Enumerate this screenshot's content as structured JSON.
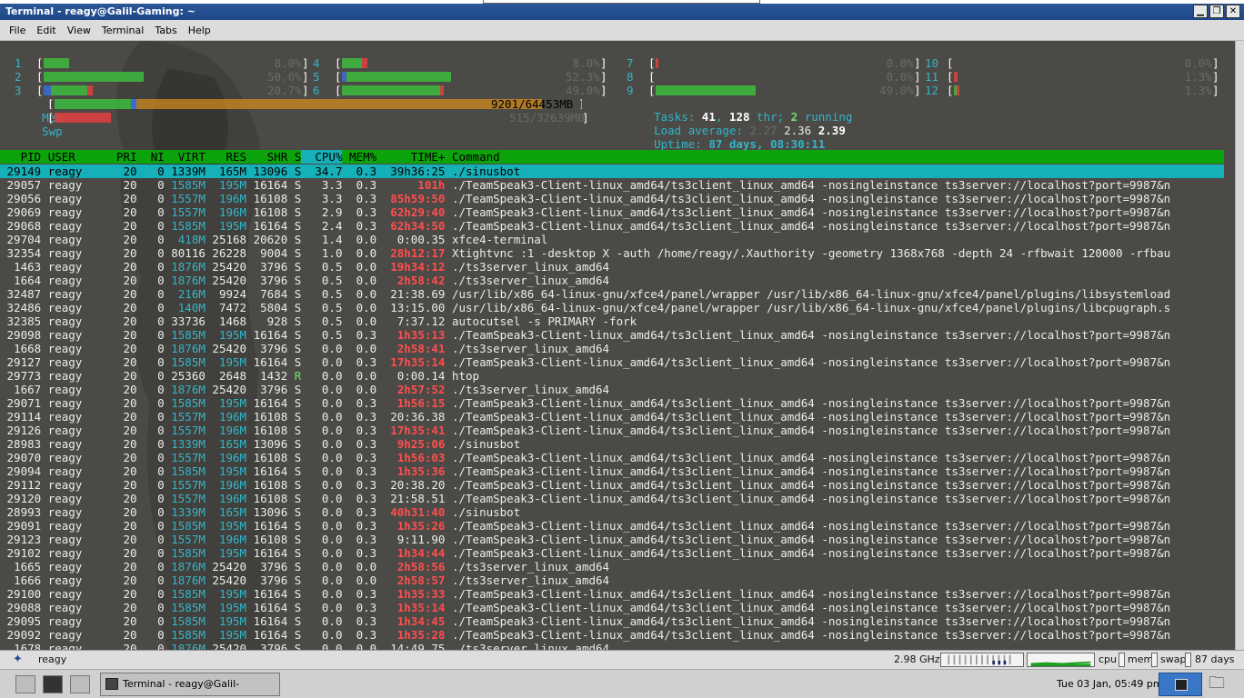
{
  "window": {
    "title": "Terminal - reagy@Galil-Gaming: ~",
    "min_glyph": "▁",
    "max_glyph": "❐",
    "close_glyph": "✕"
  },
  "menu": [
    "File",
    "Edit",
    "View",
    "Terminal",
    "Tabs",
    "Help"
  ],
  "htop": {
    "cpus_left": [
      {
        "label": "1",
        "val": "8.0%"
      },
      {
        "label": "2",
        "val": "50.0%"
      },
      {
        "label": "3",
        "val": "20.7%"
      }
    ],
    "cpus_mid": [
      {
        "label": "4",
        "val": "8.0%"
      },
      {
        "label": "5",
        "val": "52.3%"
      },
      {
        "label": "6",
        "val": "49.0%"
      }
    ],
    "cpus_r1": [
      {
        "label": "7",
        "val": "0.0%"
      },
      {
        "label": "8",
        "val": "0.0%"
      },
      {
        "label": "9",
        "val": "49.0%"
      }
    ],
    "cpus_r2": [
      {
        "label": "10",
        "val": "0.0%"
      },
      {
        "label": "11",
        "val": "1.3%"
      },
      {
        "label": "12",
        "val": "1.3%"
      }
    ],
    "mem": {
      "label": "Mem",
      "val": "9201/64453MB"
    },
    "swp": {
      "label": "Swp",
      "val": "515/32639MB"
    },
    "tasks_prefix": "Tasks: ",
    "tasks": "41",
    "tasks_sep": ", ",
    "thr": "128",
    "thr_suffix": " thr; ",
    "running": "2",
    "running_suffix": " running",
    "load_label": "Load average: ",
    "load1": "2.27",
    "load5": "2.36",
    "load15": "2.39",
    "uptime_label": "Uptime: ",
    "uptime": "87 days, 08:30:11"
  },
  "header": {
    "pid": "PID",
    "user": "USER",
    "pri": "PRI",
    "ni": "NI",
    "virt": "VIRT",
    "res": "RES",
    "shr": "SHR",
    "s": "S",
    "cpu": "CPU%",
    "mem": "MEM%",
    "time": "TIME+",
    "cmd": "Command"
  },
  "processes": [
    [
      "29149",
      "reagy",
      "20",
      "0",
      "1339M",
      "165M",
      "13096",
      "S",
      "34.7",
      "0.3",
      "39h36:25",
      "./sinusbot"
    ],
    [
      "29057",
      "reagy",
      "20",
      "0",
      "1585M",
      "195M",
      "16164",
      "S",
      "3.3",
      "0.3",
      "101h",
      "./TeamSpeak3-Client-linux_amd64/ts3client_linux_amd64 -nosinglеinstance ts3server://localhost?port=9987&n"
    ],
    [
      "29056",
      "reagy",
      "20",
      "0",
      "1557M",
      "196M",
      "16108",
      "S",
      "3.3",
      "0.3",
      "85h59:50",
      "./TeamSpeak3-Client-linux_amd64/ts3client_linux_amd64 -nosinglеinstance ts3server://localhost?port=9987&n"
    ],
    [
      "29069",
      "reagy",
      "20",
      "0",
      "1557M",
      "196M",
      "16108",
      "S",
      "2.9",
      "0.3",
      "62h29:40",
      "./TeamSpeak3-Client-linux_amd64/ts3client_linux_amd64 -nosinglеinstance ts3server://localhost?port=9987&n"
    ],
    [
      "29068",
      "reagy",
      "20",
      "0",
      "1585M",
      "195M",
      "16164",
      "S",
      "2.4",
      "0.3",
      "62h34:50",
      "./TeamSpeak3-Client-linux_amd64/ts3client_linux_amd64 -nosinglеinstance ts3server://localhost?port=9987&n"
    ],
    [
      "29704",
      "reagy",
      "20",
      "0",
      "418M",
      "25168",
      "20620",
      "S",
      "1.4",
      "0.0",
      "0:00.35",
      "xfce4-terminal"
    ],
    [
      "32354",
      "reagy",
      "20",
      "0",
      "80116",
      "26228",
      "9004",
      "S",
      "1.0",
      "0.0",
      "28h12:17",
      "Xtightvnc :1 -desktop X -auth /home/reagy/.Xauthority -geometry 1368x768 -depth 24 -rfbwait 120000 -rfbau"
    ],
    [
      "1463",
      "reagy",
      "20",
      "0",
      "1876M",
      "25420",
      "3796",
      "S",
      "0.5",
      "0.0",
      "19h34:12",
      "./ts3server_linux_amd64"
    ],
    [
      "1664",
      "reagy",
      "20",
      "0",
      "1876M",
      "25420",
      "3796",
      "S",
      "0.5",
      "0.0",
      "2h58:42",
      "./ts3server_linux_amd64"
    ],
    [
      "32487",
      "reagy",
      "20",
      "0",
      "216M",
      "9924",
      "7684",
      "S",
      "0.5",
      "0.0",
      "21:38.69",
      "/usr/lib/x86_64-linux-gnu/xfce4/panel/wrapper /usr/lib/x86_64-linux-gnu/xfce4/panel/plugins/libsystemload"
    ],
    [
      "32486",
      "reagy",
      "20",
      "0",
      "140M",
      "7472",
      "5804",
      "S",
      "0.5",
      "0.0",
      "13:15.00",
      "/usr/lib/x86_64-linux-gnu/xfce4/panel/wrapper /usr/lib/x86_64-linux-gnu/xfce4/panel/plugins/libcpugraph.s"
    ],
    [
      "32385",
      "reagy",
      "20",
      "0",
      "33736",
      "1468",
      "928",
      "S",
      "0.5",
      "0.0",
      "7:37.12",
      "autocutsel -s PRIMARY -fork"
    ],
    [
      "29098",
      "reagy",
      "20",
      "0",
      "1585M",
      "195M",
      "16164",
      "S",
      "0.5",
      "0.3",
      "1h35:13",
      "./TeamSpeak3-Client-linux_amd64/ts3client_linux_amd64 -nosinglеinstance ts3server://localhost?port=9987&n"
    ],
    [
      "1668",
      "reagy",
      "20",
      "0",
      "1876M",
      "25420",
      "3796",
      "S",
      "0.0",
      "0.0",
      "2h58:41",
      "./ts3server_linux_amd64"
    ],
    [
      "29127",
      "reagy",
      "20",
      "0",
      "1585M",
      "195M",
      "16164",
      "S",
      "0.0",
      "0.3",
      "17h35:14",
      "./TeamSpeak3-Client-linux_amd64/ts3client_linux_amd64 -nosinglеinstance ts3server://localhost?port=9987&n"
    ],
    [
      "29773",
      "reagy",
      "20",
      "0",
      "25360",
      "2648",
      "1432",
      "R",
      "0.0",
      "0.0",
      "0:00.14",
      "htop"
    ],
    [
      "1667",
      "reagy",
      "20",
      "0",
      "1876M",
      "25420",
      "3796",
      "S",
      "0.0",
      "0.0",
      "2h57:52",
      "./ts3server_linux_amd64"
    ],
    [
      "29071",
      "reagy",
      "20",
      "0",
      "1585M",
      "195M",
      "16164",
      "S",
      "0.0",
      "0.3",
      "1h56:15",
      "./TeamSpeak3-Client-linux_amd64/ts3client_linux_amd64 -nosinglеinstance ts3server://localhost?port=9987&n"
    ],
    [
      "29114",
      "reagy",
      "20",
      "0",
      "1557M",
      "196M",
      "16108",
      "S",
      "0.0",
      "0.3",
      "20:36.38",
      "./TeamSpeak3-Client-linux_amd64/ts3client_linux_amd64 -nosinglеinstance ts3server://localhost?port=9987&n"
    ],
    [
      "29126",
      "reagy",
      "20",
      "0",
      "1557M",
      "196M",
      "16108",
      "S",
      "0.0",
      "0.3",
      "17h35:41",
      "./TeamSpeak3-Client-linux_amd64/ts3client_linux_amd64 -nosinglеinstance ts3server://localhost?port=9987&n"
    ],
    [
      "28983",
      "reagy",
      "20",
      "0",
      "1339M",
      "165M",
      "13096",
      "S",
      "0.0",
      "0.3",
      "9h25:06",
      "./sinusbot"
    ],
    [
      "29070",
      "reagy",
      "20",
      "0",
      "1557M",
      "196M",
      "16108",
      "S",
      "0.0",
      "0.3",
      "1h56:03",
      "./TeamSpeak3-Client-linux_amd64/ts3client_linux_amd64 -nosinglеinstance ts3server://localhost?port=9987&n"
    ],
    [
      "29094",
      "reagy",
      "20",
      "0",
      "1585M",
      "195M",
      "16164",
      "S",
      "0.0",
      "0.3",
      "1h35:36",
      "./TeamSpeak3-Client-linux_amd64/ts3client_linux_amd64 -nosinglеinstance ts3server://localhost?port=9987&n"
    ],
    [
      "29112",
      "reagy",
      "20",
      "0",
      "1557M",
      "196M",
      "16108",
      "S",
      "0.0",
      "0.3",
      "20:38.20",
      "./TeamSpeak3-Client-linux_amd64/ts3client_linux_amd64 -nosinglеinstance ts3server://localhost?port=9987&n"
    ],
    [
      "29120",
      "reagy",
      "20",
      "0",
      "1557M",
      "196M",
      "16108",
      "S",
      "0.0",
      "0.3",
      "21:58.51",
      "./TeamSpeak3-Client-linux_amd64/ts3client_linux_amd64 -nosinglеinstance ts3server://localhost?port=9987&n"
    ],
    [
      "28993",
      "reagy",
      "20",
      "0",
      "1339M",
      "165M",
      "13096",
      "S",
      "0.0",
      "0.3",
      "40h31:40",
      "./sinusbot"
    ],
    [
      "29091",
      "reagy",
      "20",
      "0",
      "1585M",
      "195M",
      "16164",
      "S",
      "0.0",
      "0.3",
      "1h35:26",
      "./TeamSpeak3-Client-linux_amd64/ts3client_linux_amd64 -nosinglеinstance ts3server://localhost?port=9987&n"
    ],
    [
      "29123",
      "reagy",
      "20",
      "0",
      "1557M",
      "196M",
      "16108",
      "S",
      "0.0",
      "0.3",
      "9:11.90",
      "./TeamSpeak3-Client-linux_amd64/ts3client_linux_amd64 -nosinglеinstance ts3server://localhost?port=9987&n"
    ],
    [
      "29102",
      "reagy",
      "20",
      "0",
      "1585M",
      "195M",
      "16164",
      "S",
      "0.0",
      "0.3",
      "1h34:44",
      "./TeamSpeak3-Client-linux_amd64/ts3client_linux_amd64 -nosinglеinstance ts3server://localhost?port=9987&n"
    ],
    [
      "1665",
      "reagy",
      "20",
      "0",
      "1876M",
      "25420",
      "3796",
      "S",
      "0.0",
      "0.0",
      "2h58:56",
      "./ts3server_linux_amd64"
    ],
    [
      "1666",
      "reagy",
      "20",
      "0",
      "1876M",
      "25420",
      "3796",
      "S",
      "0.0",
      "0.0",
      "2h58:57",
      "./ts3server_linux_amd64"
    ],
    [
      "29100",
      "reagy",
      "20",
      "0",
      "1585M",
      "195M",
      "16164",
      "S",
      "0.0",
      "0.3",
      "1h35:33",
      "./TeamSpeak3-Client-linux_amd64/ts3client_linux_amd64 -nosinglеinstance ts3server://localhost?port=9987&n"
    ],
    [
      "29088",
      "reagy",
      "20",
      "0",
      "1585M",
      "195M",
      "16164",
      "S",
      "0.0",
      "0.3",
      "1h35:14",
      "./TeamSpeak3-Client-linux_amd64/ts3client_linux_amd64 -nosinglеinstance ts3server://localhost?port=9987&n"
    ],
    [
      "29095",
      "reagy",
      "20",
      "0",
      "1585M",
      "195M",
      "16164",
      "S",
      "0.0",
      "0.3",
      "1h34:45",
      "./TeamSpeak3-Client-linux_amd64/ts3client_linux_amd64 -nosinglеinstance ts3server://localhost?port=9987&n"
    ],
    [
      "29092",
      "reagy",
      "20",
      "0",
      "1585M",
      "195M",
      "16164",
      "S",
      "0.0",
      "0.3",
      "1h35:28",
      "./TeamSpeak3-Client-linux_amd64/ts3client_linux_amd64 -nosinglеinstance ts3server://localhost?port=9987&n"
    ],
    [
      "1678",
      "reagy",
      "20",
      "0",
      "1876M",
      "25420",
      "3796",
      "S",
      "0.0",
      "0.0",
      "14:49.75",
      "./ts3server_linux_amd64"
    ]
  ],
  "panel": {
    "user": "reagy",
    "ghz": "2.98 GHz",
    "cpu_label": "cpu",
    "mem_label": "mem",
    "swap_label": "swap",
    "uptime": "87 days"
  },
  "taskbar": {
    "task_label": "Terminal - reagy@Galil-Gaming: ~",
    "clock": "Tue 03 Jan, 05:49 pm"
  },
  "colors": {
    "terminal_bg": "#4b4a46",
    "header_bg": "#0ca30c",
    "selected_bg": "#16b0b8",
    "cyan": "#33b5c9",
    "red": "#ff4e4e"
  }
}
